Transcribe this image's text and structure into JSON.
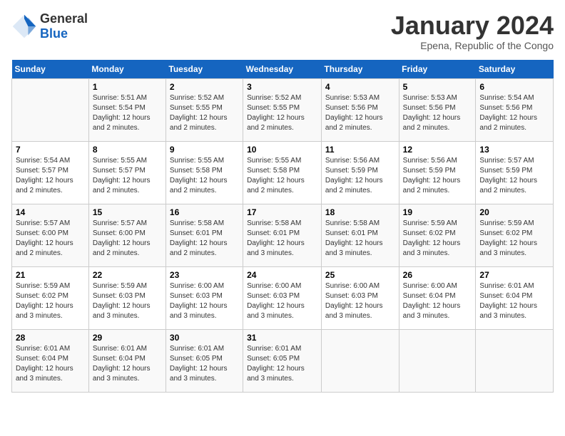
{
  "header": {
    "logo_general": "General",
    "logo_blue": "Blue",
    "month_title": "January 2024",
    "subtitle": "Epena, Republic of the Congo"
  },
  "weekdays": [
    "Sunday",
    "Monday",
    "Tuesday",
    "Wednesday",
    "Thursday",
    "Friday",
    "Saturday"
  ],
  "weeks": [
    [
      {
        "day": "",
        "info": ""
      },
      {
        "day": "1",
        "info": "Sunrise: 5:51 AM\nSunset: 5:54 PM\nDaylight: 12 hours\nand 2 minutes."
      },
      {
        "day": "2",
        "info": "Sunrise: 5:52 AM\nSunset: 5:55 PM\nDaylight: 12 hours\nand 2 minutes."
      },
      {
        "day": "3",
        "info": "Sunrise: 5:52 AM\nSunset: 5:55 PM\nDaylight: 12 hours\nand 2 minutes."
      },
      {
        "day": "4",
        "info": "Sunrise: 5:53 AM\nSunset: 5:56 PM\nDaylight: 12 hours\nand 2 minutes."
      },
      {
        "day": "5",
        "info": "Sunrise: 5:53 AM\nSunset: 5:56 PM\nDaylight: 12 hours\nand 2 minutes."
      },
      {
        "day": "6",
        "info": "Sunrise: 5:54 AM\nSunset: 5:56 PM\nDaylight: 12 hours\nand 2 minutes."
      }
    ],
    [
      {
        "day": "7",
        "info": "Sunrise: 5:54 AM\nSunset: 5:57 PM\nDaylight: 12 hours\nand 2 minutes."
      },
      {
        "day": "8",
        "info": "Sunrise: 5:55 AM\nSunset: 5:57 PM\nDaylight: 12 hours\nand 2 minutes."
      },
      {
        "day": "9",
        "info": "Sunrise: 5:55 AM\nSunset: 5:58 PM\nDaylight: 12 hours\nand 2 minutes."
      },
      {
        "day": "10",
        "info": "Sunrise: 5:55 AM\nSunset: 5:58 PM\nDaylight: 12 hours\nand 2 minutes."
      },
      {
        "day": "11",
        "info": "Sunrise: 5:56 AM\nSunset: 5:59 PM\nDaylight: 12 hours\nand 2 minutes."
      },
      {
        "day": "12",
        "info": "Sunrise: 5:56 AM\nSunset: 5:59 PM\nDaylight: 12 hours\nand 2 minutes."
      },
      {
        "day": "13",
        "info": "Sunrise: 5:57 AM\nSunset: 5:59 PM\nDaylight: 12 hours\nand 2 minutes."
      }
    ],
    [
      {
        "day": "14",
        "info": "Sunrise: 5:57 AM\nSunset: 6:00 PM\nDaylight: 12 hours\nand 2 minutes."
      },
      {
        "day": "15",
        "info": "Sunrise: 5:57 AM\nSunset: 6:00 PM\nDaylight: 12 hours\nand 2 minutes."
      },
      {
        "day": "16",
        "info": "Sunrise: 5:58 AM\nSunset: 6:01 PM\nDaylight: 12 hours\nand 2 minutes."
      },
      {
        "day": "17",
        "info": "Sunrise: 5:58 AM\nSunset: 6:01 PM\nDaylight: 12 hours\nand 3 minutes."
      },
      {
        "day": "18",
        "info": "Sunrise: 5:58 AM\nSunset: 6:01 PM\nDaylight: 12 hours\nand 3 minutes."
      },
      {
        "day": "19",
        "info": "Sunrise: 5:59 AM\nSunset: 6:02 PM\nDaylight: 12 hours\nand 3 minutes."
      },
      {
        "day": "20",
        "info": "Sunrise: 5:59 AM\nSunset: 6:02 PM\nDaylight: 12 hours\nand 3 minutes."
      }
    ],
    [
      {
        "day": "21",
        "info": "Sunrise: 5:59 AM\nSunset: 6:02 PM\nDaylight: 12 hours\nand 3 minutes."
      },
      {
        "day": "22",
        "info": "Sunrise: 5:59 AM\nSunset: 6:03 PM\nDaylight: 12 hours\nand 3 minutes."
      },
      {
        "day": "23",
        "info": "Sunrise: 6:00 AM\nSunset: 6:03 PM\nDaylight: 12 hours\nand 3 minutes."
      },
      {
        "day": "24",
        "info": "Sunrise: 6:00 AM\nSunset: 6:03 PM\nDaylight: 12 hours\nand 3 minutes."
      },
      {
        "day": "25",
        "info": "Sunrise: 6:00 AM\nSunset: 6:03 PM\nDaylight: 12 hours\nand 3 minutes."
      },
      {
        "day": "26",
        "info": "Sunrise: 6:00 AM\nSunset: 6:04 PM\nDaylight: 12 hours\nand 3 minutes."
      },
      {
        "day": "27",
        "info": "Sunrise: 6:01 AM\nSunset: 6:04 PM\nDaylight: 12 hours\nand 3 minutes."
      }
    ],
    [
      {
        "day": "28",
        "info": "Sunrise: 6:01 AM\nSunset: 6:04 PM\nDaylight: 12 hours\nand 3 minutes."
      },
      {
        "day": "29",
        "info": "Sunrise: 6:01 AM\nSunset: 6:04 PM\nDaylight: 12 hours\nand 3 minutes."
      },
      {
        "day": "30",
        "info": "Sunrise: 6:01 AM\nSunset: 6:05 PM\nDaylight: 12 hours\nand 3 minutes."
      },
      {
        "day": "31",
        "info": "Sunrise: 6:01 AM\nSunset: 6:05 PM\nDaylight: 12 hours\nand 3 minutes."
      },
      {
        "day": "",
        "info": ""
      },
      {
        "day": "",
        "info": ""
      },
      {
        "day": "",
        "info": ""
      }
    ]
  ]
}
